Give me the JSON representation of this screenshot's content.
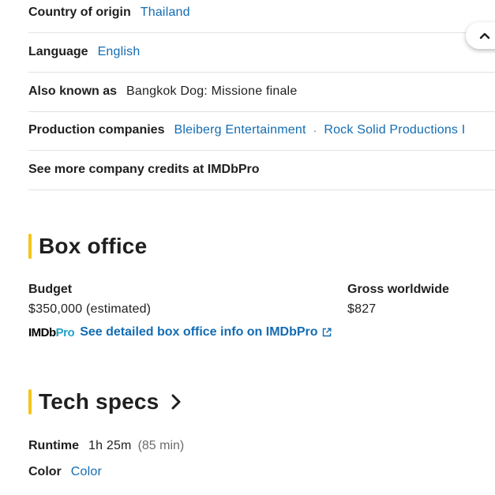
{
  "details": {
    "country": {
      "label": "Country of origin",
      "value": "Thailand"
    },
    "language": {
      "label": "Language",
      "value": "English"
    },
    "aka": {
      "label": "Also known as",
      "value": "Bangkok Dog: Missione finale"
    },
    "production": {
      "label": "Production companies",
      "companies": [
        "Bleiberg Entertainment",
        "Rock Solid Productions I"
      ],
      "separator": "·"
    },
    "more_credits": {
      "label": "See more company credits at IMDbPro"
    }
  },
  "box_office": {
    "title": "Box office",
    "budget": {
      "label": "Budget",
      "value": "$350,000 (estimated)"
    },
    "gross": {
      "label": "Gross worldwide",
      "value": "$827"
    },
    "imdbpro": {
      "logo_part1": "IMDb",
      "logo_part2": "Pro",
      "link": "See detailed box office info on IMDbPro"
    }
  },
  "tech_specs": {
    "title": "Tech specs",
    "runtime": {
      "label": "Runtime",
      "value": "1h 25m",
      "detail": "(85 min)"
    },
    "color": {
      "label": "Color",
      "value": "Color"
    }
  },
  "colors": {
    "link": "#136cb2",
    "accent": "#f5c518",
    "pro_accent": "#21a2c7",
    "divider": "#e2e2e2"
  },
  "icons": {
    "scroll_top": "chevron-up-icon",
    "section_arrow": "chevron-right-icon",
    "external": "external-link-icon"
  }
}
